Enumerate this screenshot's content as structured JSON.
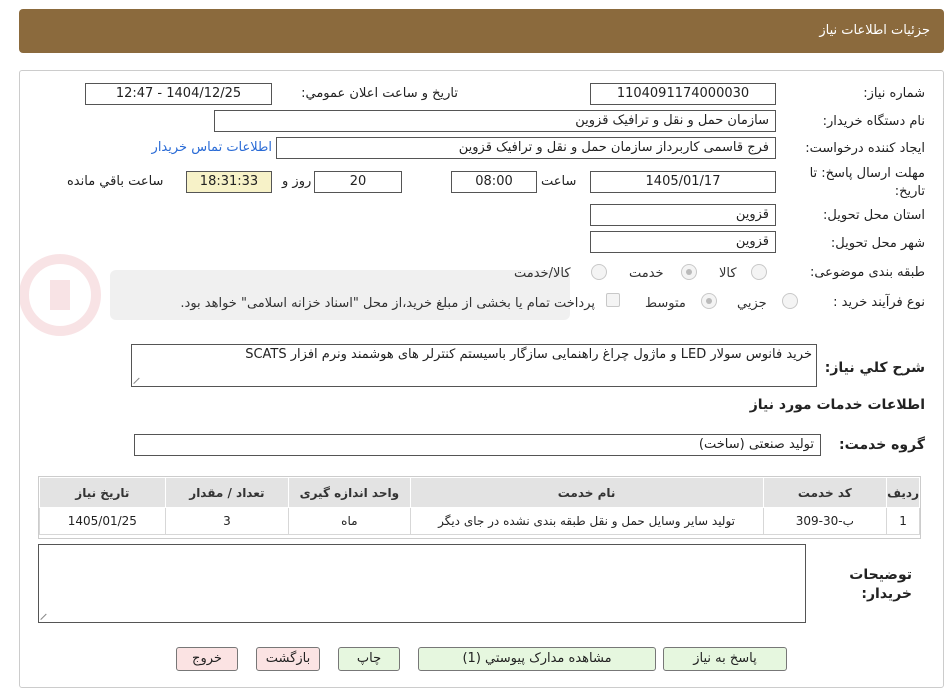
{
  "header": {
    "title": "جزئيات اطلاعات نياز"
  },
  "form": {
    "need_number": {
      "label": "شماره نياز:",
      "value": "1104091174000030"
    },
    "announce": {
      "label": "تاريخ و ساعت اعلان عمومي:",
      "value": "1404/12/25 - 12:47"
    },
    "buyer_org": {
      "label": "نام دستگاه خريدار:",
      "value": "سازمان حمل و نقل و ترافيک قزوين"
    },
    "requester": {
      "label": "ايجاد کننده درخواست:",
      "value": "فرج قاسمی کاربرداز سازمان حمل و نقل و ترافيک قزوين"
    },
    "contact_link": "اطلاعات تماس خريدار",
    "deadline": {
      "label_line1": "مهلت ارسال پاسخ: تا",
      "label_line2": "تاريخ:",
      "date": "1405/01/17",
      "time_label": "ساعت",
      "time": "08:00",
      "days": "20",
      "days_label": "روز و",
      "remaining": "18:31:33",
      "remaining_label": "ساعت باقي مانده"
    },
    "province": {
      "label": "استان محل تحويل:",
      "value": "قزوين"
    },
    "city": {
      "label": "شهر محل تحويل:",
      "value": "قزوين"
    },
    "category": {
      "label": "طبقه بندی موضوعی:",
      "options": [
        "کالا",
        "خدمت",
        "کالا/خدمت"
      ],
      "selected": "خدمت"
    },
    "process": {
      "label": "نوع فرآيند خريد :",
      "options": [
        "جزيي",
        "متوسط"
      ],
      "selected": "متوسط",
      "note": "پرداخت تمام يا بخشی از مبلغ خريد،از محل \"اسناد خزانه اسلامی\" خواهد بود."
    },
    "description": {
      "label": "شرح کلي نياز:",
      "value": "خريد فانوس سولار LED و ماژول چراغ راهنمایی سازگار باسیستم کنترلر های هوشمند ونرم افزار SCATS"
    },
    "services_title": "اطلاعات خدمات مورد نياز",
    "service_group": {
      "label": "گروه خدمت:",
      "value": "توليد صنعتی (ساخت)"
    },
    "buyer_notes": {
      "label_line1": "توضيحات",
      "label_line2": "خريدار:",
      "value": ""
    }
  },
  "table": {
    "headers": [
      "رديف",
      "کد خدمت",
      "نام خدمت",
      "واحد اندازه گيری",
      "تعداد / مقدار",
      "تاريخ نياز"
    ],
    "rows": [
      [
        "1",
        "ب-30-309",
        "توليد ساير وسايل حمل و نقل طبقه بندی نشده در جای ديگر",
        "ماه",
        "3",
        "1405/01/25"
      ]
    ]
  },
  "buttons": {
    "reply": "پاسخ به نياز",
    "attachments": "مشاهده مدارک پيوستي (1)",
    "print": "چاپ",
    "back": "بازگشت",
    "exit": "خروج"
  },
  "colors": {
    "header_bg": "#8b6a3d",
    "link": "#2a6bd6",
    "green_btn": "#e6f7df",
    "pink_btn": "#fbe3e3"
  }
}
